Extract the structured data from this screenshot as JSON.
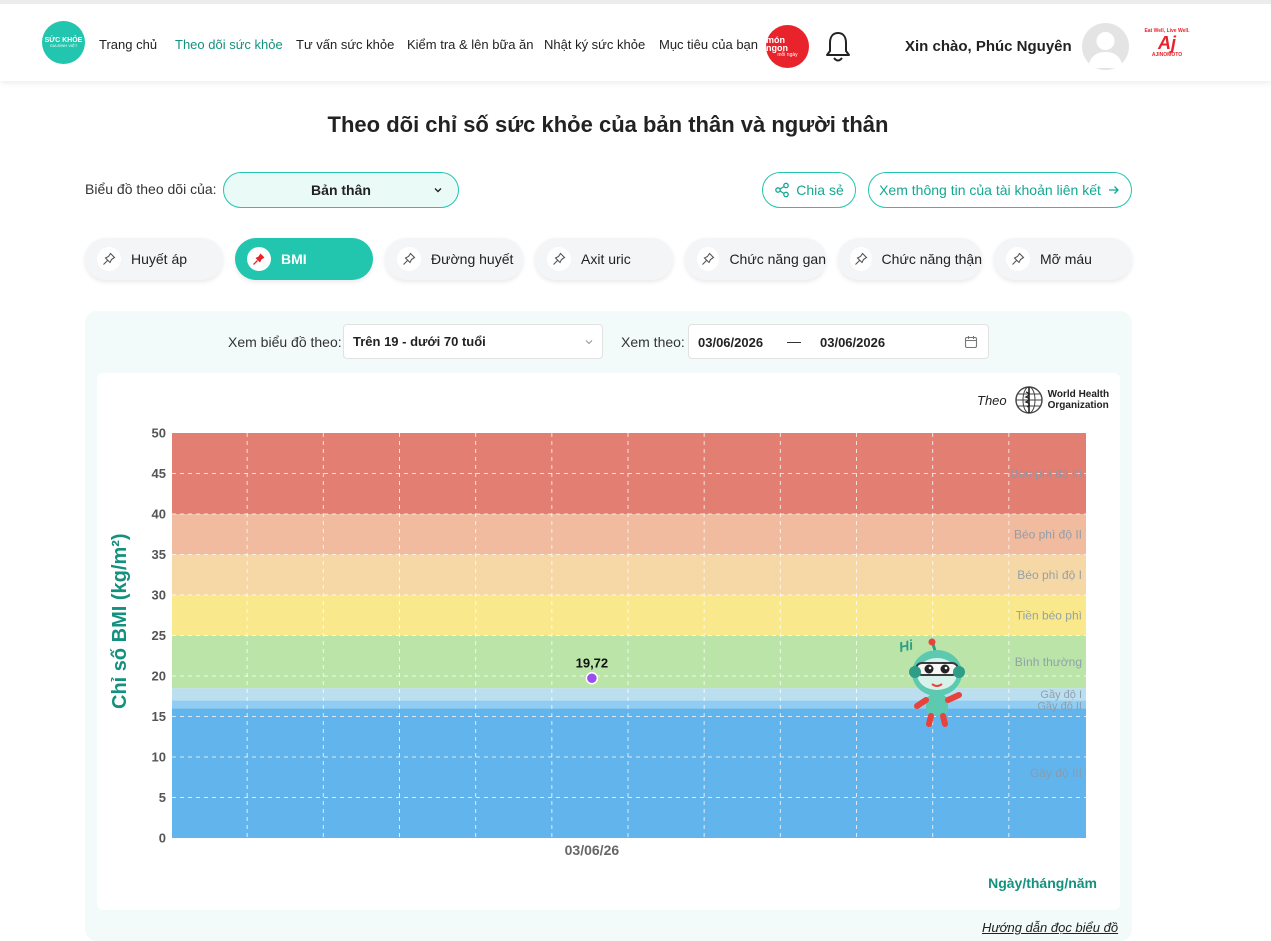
{
  "header": {
    "logo_text": "SỨC KHỎE",
    "logo_sub": "GIA ĐÌNH VIỆT",
    "nav": [
      {
        "label": "Trang chủ",
        "active": false
      },
      {
        "label": "Theo dõi sức khỏe",
        "active": true
      },
      {
        "label": "Tư vấn sức khỏe",
        "active": false
      },
      {
        "label": "Kiểm tra & lên bữa ăn",
        "active": false
      },
      {
        "label": "Nhật ký sức khỏe",
        "active": false
      },
      {
        "label": "Mục tiêu của bạn",
        "active": false
      }
    ],
    "mon_logo": "món ngon",
    "mon_logo_sub": "mỗi ngày",
    "greeting": "Xin chào, Phúc Nguyên",
    "ajinomoto_tagline": "Eat Well, Live Well.",
    "ajinomoto_logo": "Aj",
    "ajinomoto_name": "AJINOMOTO"
  },
  "page_title": "Theo dõi chỉ số sức khỏe của bản thân và người thân",
  "subject": {
    "label": "Biểu đồ theo dõi của:",
    "value": "Bản thân"
  },
  "actions": {
    "share": "Chia sẻ",
    "linked": "Xem thông tin của tài khoản liên kết"
  },
  "tabs": [
    {
      "label": "Huyết áp",
      "active": false
    },
    {
      "label": "BMI",
      "active": true
    },
    {
      "label": "Đường huyết",
      "active": false
    },
    {
      "label": "Axit uric",
      "active": false
    },
    {
      "label": "Chức năng gan",
      "active": false
    },
    {
      "label": "Chức năng thận",
      "active": false
    },
    {
      "label": "Mỡ máu",
      "active": false
    }
  ],
  "filters": {
    "chart_label": "Xem biểu đồ theo:",
    "age_value": "Trên 19 - dưới 70 tuổi",
    "range_label": "Xem theo:",
    "date_from": "03/06/2026",
    "date_sep": "—",
    "date_to": "03/06/2026"
  },
  "source": {
    "prefix": "Theo",
    "org": "World Health Organization",
    "org_line1": "World Health",
    "org_line2": "Organization"
  },
  "mascot_greeting": "Hi",
  "guide_link": "Hướng dẫn đọc biểu đồ",
  "colors": {
    "accent": "#22c5ad",
    "accent_dark": "#14917e",
    "point": "#9b4dee"
  },
  "chart_data": {
    "type": "scatter",
    "ylabel": "Chỉ số BMI (kg/m²)",
    "xlabel": "Ngày/tháng/năm",
    "ylim": [
      0,
      50
    ],
    "yticks": [
      0,
      5,
      10,
      15,
      20,
      25,
      30,
      35,
      40,
      45,
      50
    ],
    "x_categories": [
      "03/06/26"
    ],
    "points": [
      {
        "x": "03/06/26",
        "y": 19.72,
        "label": "19,72"
      }
    ],
    "grid": true,
    "bands": [
      {
        "name": "Gầy độ III",
        "from": 0,
        "to": 16,
        "color": "#62b4ec"
      },
      {
        "name": "Gầy độ II",
        "from": 16,
        "to": 17,
        "color": "#91cdf2"
      },
      {
        "name": "Gầy độ I",
        "from": 17,
        "to": 18.5,
        "color": "#bcdff0"
      },
      {
        "name": "Bình thường",
        "from": 18.5,
        "to": 25,
        "color": "#bbe5a8"
      },
      {
        "name": "Tiền béo phì",
        "from": 25,
        "to": 30,
        "color": "#f9e98c"
      },
      {
        "name": "Béo phì độ I",
        "from": 30,
        "to": 35,
        "color": "#f6d8a6"
      },
      {
        "name": "Béo phì độ II",
        "from": 35,
        "to": 40,
        "color": "#f0bb9f"
      },
      {
        "name": "Béo phì độ III",
        "from": 40,
        "to": 50,
        "color": "#e27e72"
      }
    ]
  }
}
